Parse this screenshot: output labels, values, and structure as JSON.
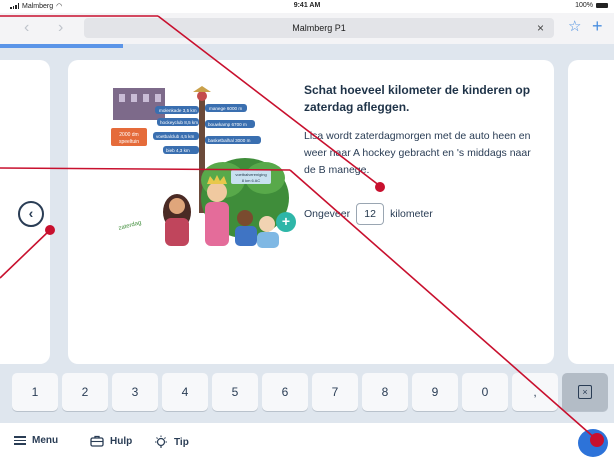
{
  "status_bar": {
    "carrier": "Malmberg",
    "time": "9:41 AM",
    "battery": "100%"
  },
  "browser": {
    "url_title": "Malmberg P1",
    "close_glyph": "×",
    "back_glyph": "‹",
    "forward_glyph": "›",
    "star_icon": "star-icon",
    "plus_icon": "plus-icon"
  },
  "progress": {
    "fraction": 0.2
  },
  "task": {
    "title": "Schat hoeveel kilometer de kinderen op zaterdag afleggen.",
    "body": "Lisa wordt zaterdagmorgen met de auto heen en weer naar A hockey gebracht en 's middags naar de B manege.",
    "answer_prefix": "Ongeveer",
    "answer_value": "12",
    "answer_unit": "kilometer"
  },
  "illustration": {
    "signs": [
      "molenkade 3,5 km",
      "manege 6000 m",
      "hockeyclub 8,5 km",
      "bouwkamp 6700 m",
      "voetbalclub 4,5 km",
      "basketbalhal 3000 m",
      "bieb 4,3 km"
    ],
    "distance_board": "2000 dm speeltuin",
    "tree_sign": "voetbalvereniging 8 km 6 AC"
  },
  "keypad": {
    "keys": [
      "1",
      "2",
      "3",
      "4",
      "5",
      "6",
      "7",
      "8",
      "9",
      "0",
      ","
    ],
    "delete_icon": "backspace-icon"
  },
  "bottom_bar": {
    "menu_label": "Menu",
    "help_label": "Hulp",
    "tip_label": "Tip"
  },
  "colors": {
    "accent": "#5b95e8",
    "annotation": "#c8102e",
    "next_button": "#2d73d9",
    "text": "#1f3348"
  }
}
